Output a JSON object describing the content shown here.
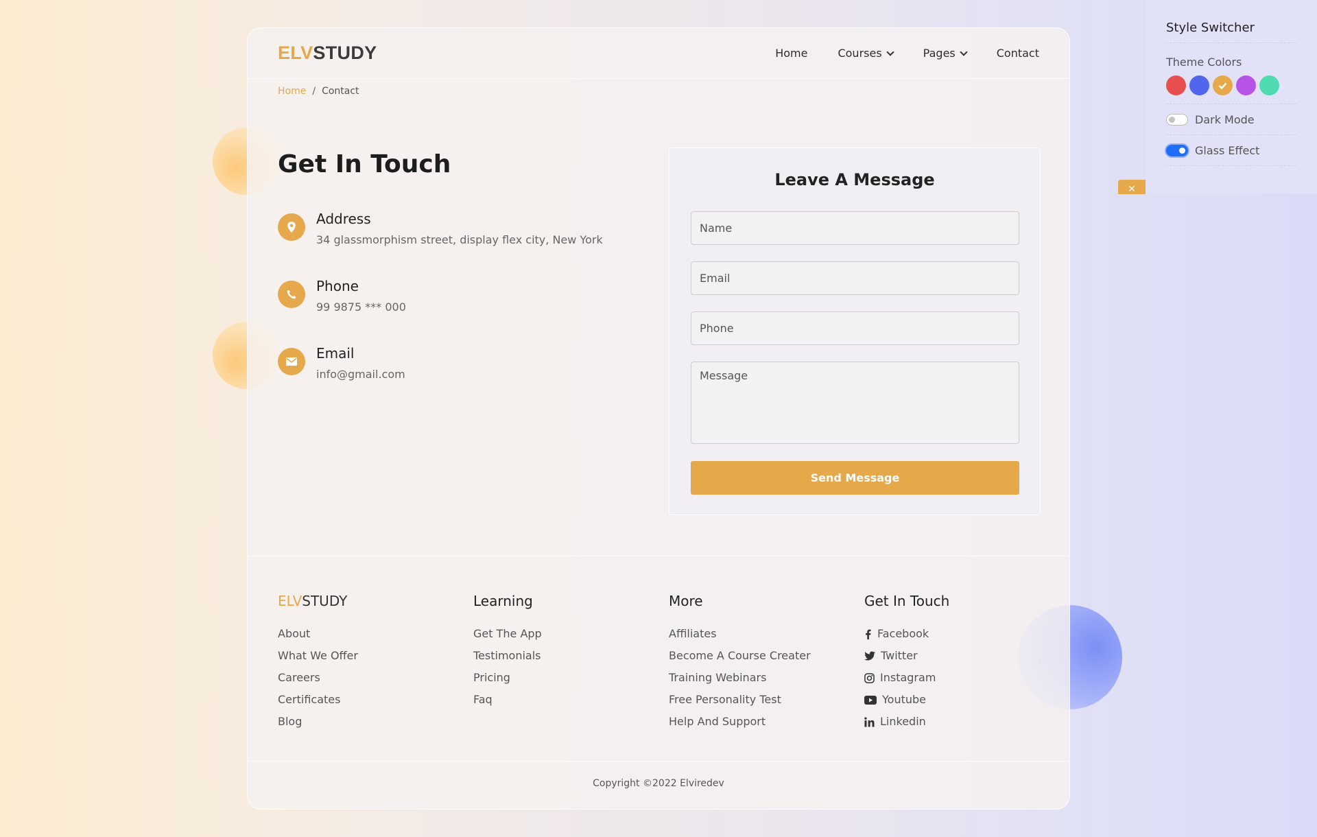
{
  "colors": {
    "accent": "#e5a84b",
    "toggle_on": "#1f6ef7"
  },
  "header": {
    "logo_part1": "ELV",
    "logo_part2": "STUDY",
    "nav": [
      {
        "label": "Home"
      },
      {
        "label": "Courses",
        "dropdown": true
      },
      {
        "label": "Pages",
        "dropdown": true
      },
      {
        "label": "Contact"
      }
    ]
  },
  "breadcrumb": {
    "home": "Home",
    "separator": "/",
    "current": "Contact"
  },
  "contact": {
    "title": "Get In Touch",
    "items": [
      {
        "icon": "map-pin-icon",
        "label": "Address",
        "value": "34 glassmorphism street, display flex city, New York"
      },
      {
        "icon": "phone-icon",
        "label": "Phone",
        "value": "99 9875 *** 000"
      },
      {
        "icon": "envelope-icon",
        "label": "Email",
        "value": "info@gmail.com"
      }
    ]
  },
  "form": {
    "title": "Leave A Message",
    "name_placeholder": "Name",
    "email_placeholder": "Email",
    "phone_placeholder": "Phone",
    "message_placeholder": "Message",
    "submit_label": "Send Message"
  },
  "footer": {
    "logo_part1": "ELV",
    "logo_part2": "STUDY",
    "col1_links": [
      "About",
      "What We Offer",
      "Careers",
      "Certificates",
      "Blog"
    ],
    "learning": {
      "title": "Learning",
      "links": [
        "Get The App",
        "Testimonials",
        "Pricing",
        "Faq"
      ]
    },
    "more": {
      "title": "More",
      "links": [
        "Affiliates",
        "Become A Course Creater",
        "Training Webinars",
        "Free Personality Test",
        "Help And Support"
      ]
    },
    "touch": {
      "title": "Get In Touch",
      "links": [
        {
          "icon": "facebook-icon",
          "label": "Facebook"
        },
        {
          "icon": "twitter-icon",
          "label": "Twitter"
        },
        {
          "icon": "instagram-icon",
          "label": "Instagram"
        },
        {
          "icon": "youtube-icon",
          "label": "Youtube"
        },
        {
          "icon": "linkedin-icon",
          "label": "Linkedin"
        }
      ]
    },
    "copyright": "Copyright ©2022 Elviredev"
  },
  "switcher": {
    "title": "Style Switcher",
    "theme_label": "Theme Colors",
    "theme_colors": [
      "#e8504f",
      "#5166ec",
      "#e5a84b",
      "#b753e6",
      "#4fdbb1"
    ],
    "selected_color": "#e5a84b",
    "dark_mode_label": "Dark Mode",
    "dark_mode_on": false,
    "glass_label": "Glass Effect",
    "glass_on": true
  }
}
